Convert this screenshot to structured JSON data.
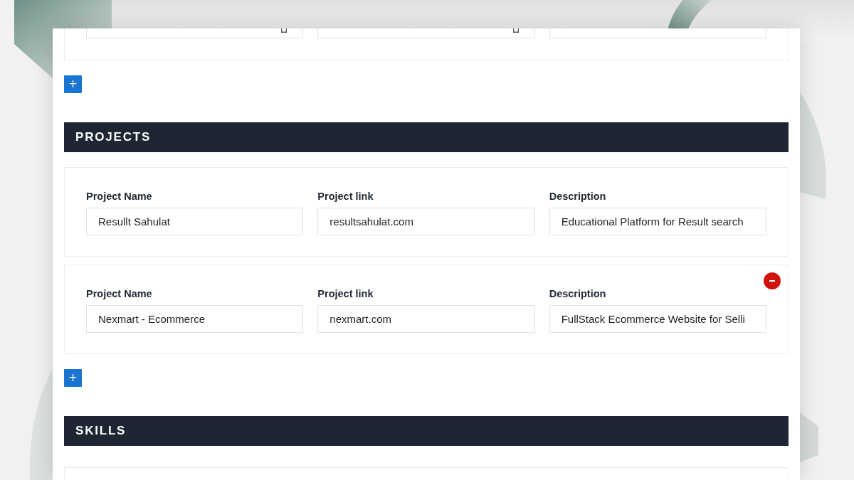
{
  "top_section": {
    "fields": [
      {
        "has_icon": true
      },
      {
        "has_icon": true
      },
      {
        "has_icon": false
      }
    ],
    "add_button": "+"
  },
  "sections": [
    {
      "title": "PROJECTS",
      "entries": [
        {
          "removable": false,
          "fields": [
            {
              "label": "Project Name",
              "value": "Resullt Sahulat"
            },
            {
              "label": "Project link",
              "value": "resultsahulat.com"
            },
            {
              "label": "Description",
              "value": "Educational Platform for Result search"
            }
          ]
        },
        {
          "removable": true,
          "fields": [
            {
              "label": "Project Name",
              "value": "Nexmart - Ecommerce"
            },
            {
              "label": "Project link",
              "value": "nexmart.com"
            },
            {
              "label": "Description",
              "value": "FullStack Ecommerce Website for Selli"
            }
          ]
        }
      ],
      "add_button": "+"
    },
    {
      "title": "SKILLS",
      "entries": [
        {
          "removable": false
        }
      ]
    }
  ]
}
